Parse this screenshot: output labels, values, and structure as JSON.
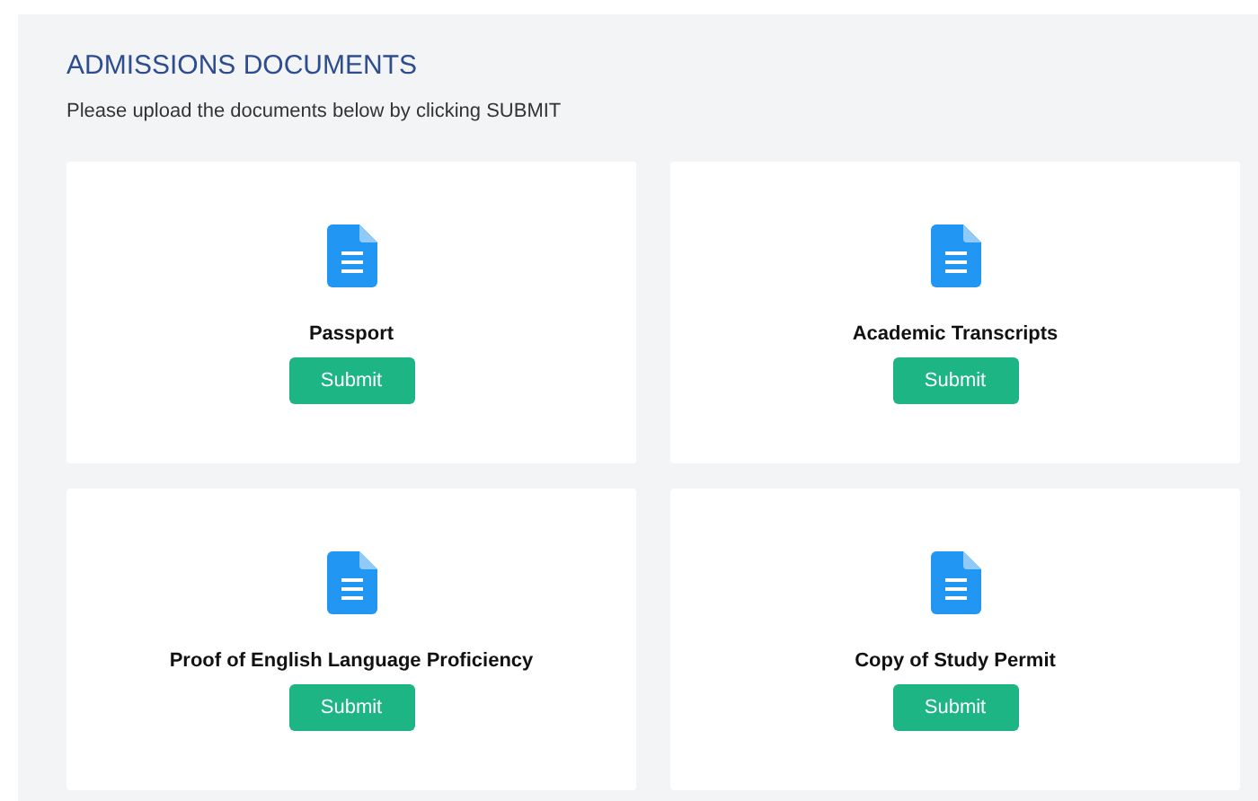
{
  "header": {
    "title": "ADMISSIONS DOCUMENTS",
    "instructions": "Please upload the documents below by clicking SUBMIT"
  },
  "documents": [
    {
      "name": "Passport",
      "button": "Submit"
    },
    {
      "name": "Academic Transcripts",
      "button": "Submit"
    },
    {
      "name": "Proof of English Language Proficiency",
      "button": "Submit"
    },
    {
      "name": "Copy of Study Permit",
      "button": "Submit"
    }
  ]
}
